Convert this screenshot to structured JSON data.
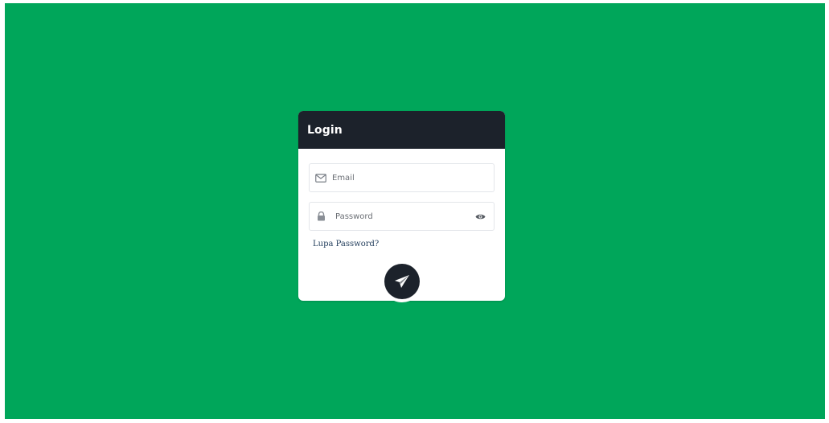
{
  "login_card": {
    "title": "Login",
    "email_field": {
      "placeholder": "Email",
      "value": "",
      "icon": "envelope-icon"
    },
    "password_field": {
      "placeholder": "Password",
      "value": "",
      "icon": "lock-icon",
      "toggle_icon": "eye-icon"
    },
    "forgot_link": "Lupa Password?",
    "submit_icon": "paper-plane-icon"
  },
  "colors": {
    "background": "#00a65a",
    "header": "#1c222b",
    "card": "#ffffff",
    "link": "#1f3b5a"
  }
}
